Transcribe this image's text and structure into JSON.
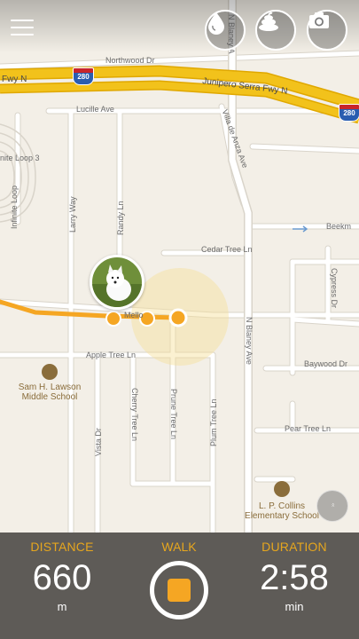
{
  "map": {
    "streets": {
      "northwood": "Northwood Dr",
      "junipero_left": "Fwy N",
      "junipero": "Junipero Serra Fwy N",
      "lucille": "Lucille Ave",
      "villa_de_anza": "Villa de Anza Ave",
      "n_blaney_top": "N Blaney A",
      "n_blaney": "N Blaney Ave",
      "infinite_loop_3": "nite Loop 3",
      "infinite_loop": "Infinite Loop",
      "larry_way": "Larry Way",
      "randy_ln": "Randy Ln",
      "beekman": "Beekm",
      "cedar_tree": "Cedar Tree Ln",
      "cypress": "Cypress Dr",
      "mello": "Mello",
      "apple_tree": "Apple Tree Ln",
      "baywood": "Baywood Dr",
      "vista_dr": "Vista Dr",
      "cherry_tree": "Cherry Tree Ln",
      "prune_tree": "Prune Tree Ln",
      "plum_tree": "Plum Tree Ln",
      "pear_tree": "Pear Tree Ln"
    },
    "highway_shield": "280",
    "pois": {
      "lawson_line1": "Sam H. Lawson",
      "lawson_line2": "Middle School",
      "collins_line1": "L. P. Collins",
      "collins_line2": "Elementary School"
    },
    "route_color": "#f5a623",
    "highway_color": "#f2c21b"
  },
  "toolbar": {
    "menu_icon": "hamburger-menu-icon",
    "water_icon": "water-drop-icon",
    "poop_icon": "poop-icon",
    "camera_icon": "camera-icon"
  },
  "side_handle": "‹‹",
  "panel": {
    "distance_label": "DISTANCE",
    "distance_value": "660",
    "distance_unit": "m",
    "walk_label": "WALK",
    "duration_label": "DURATION",
    "duration_value": "2:58",
    "duration_unit": "min",
    "accent_color": "#e6a61e",
    "background_color": "#5e5b57"
  }
}
